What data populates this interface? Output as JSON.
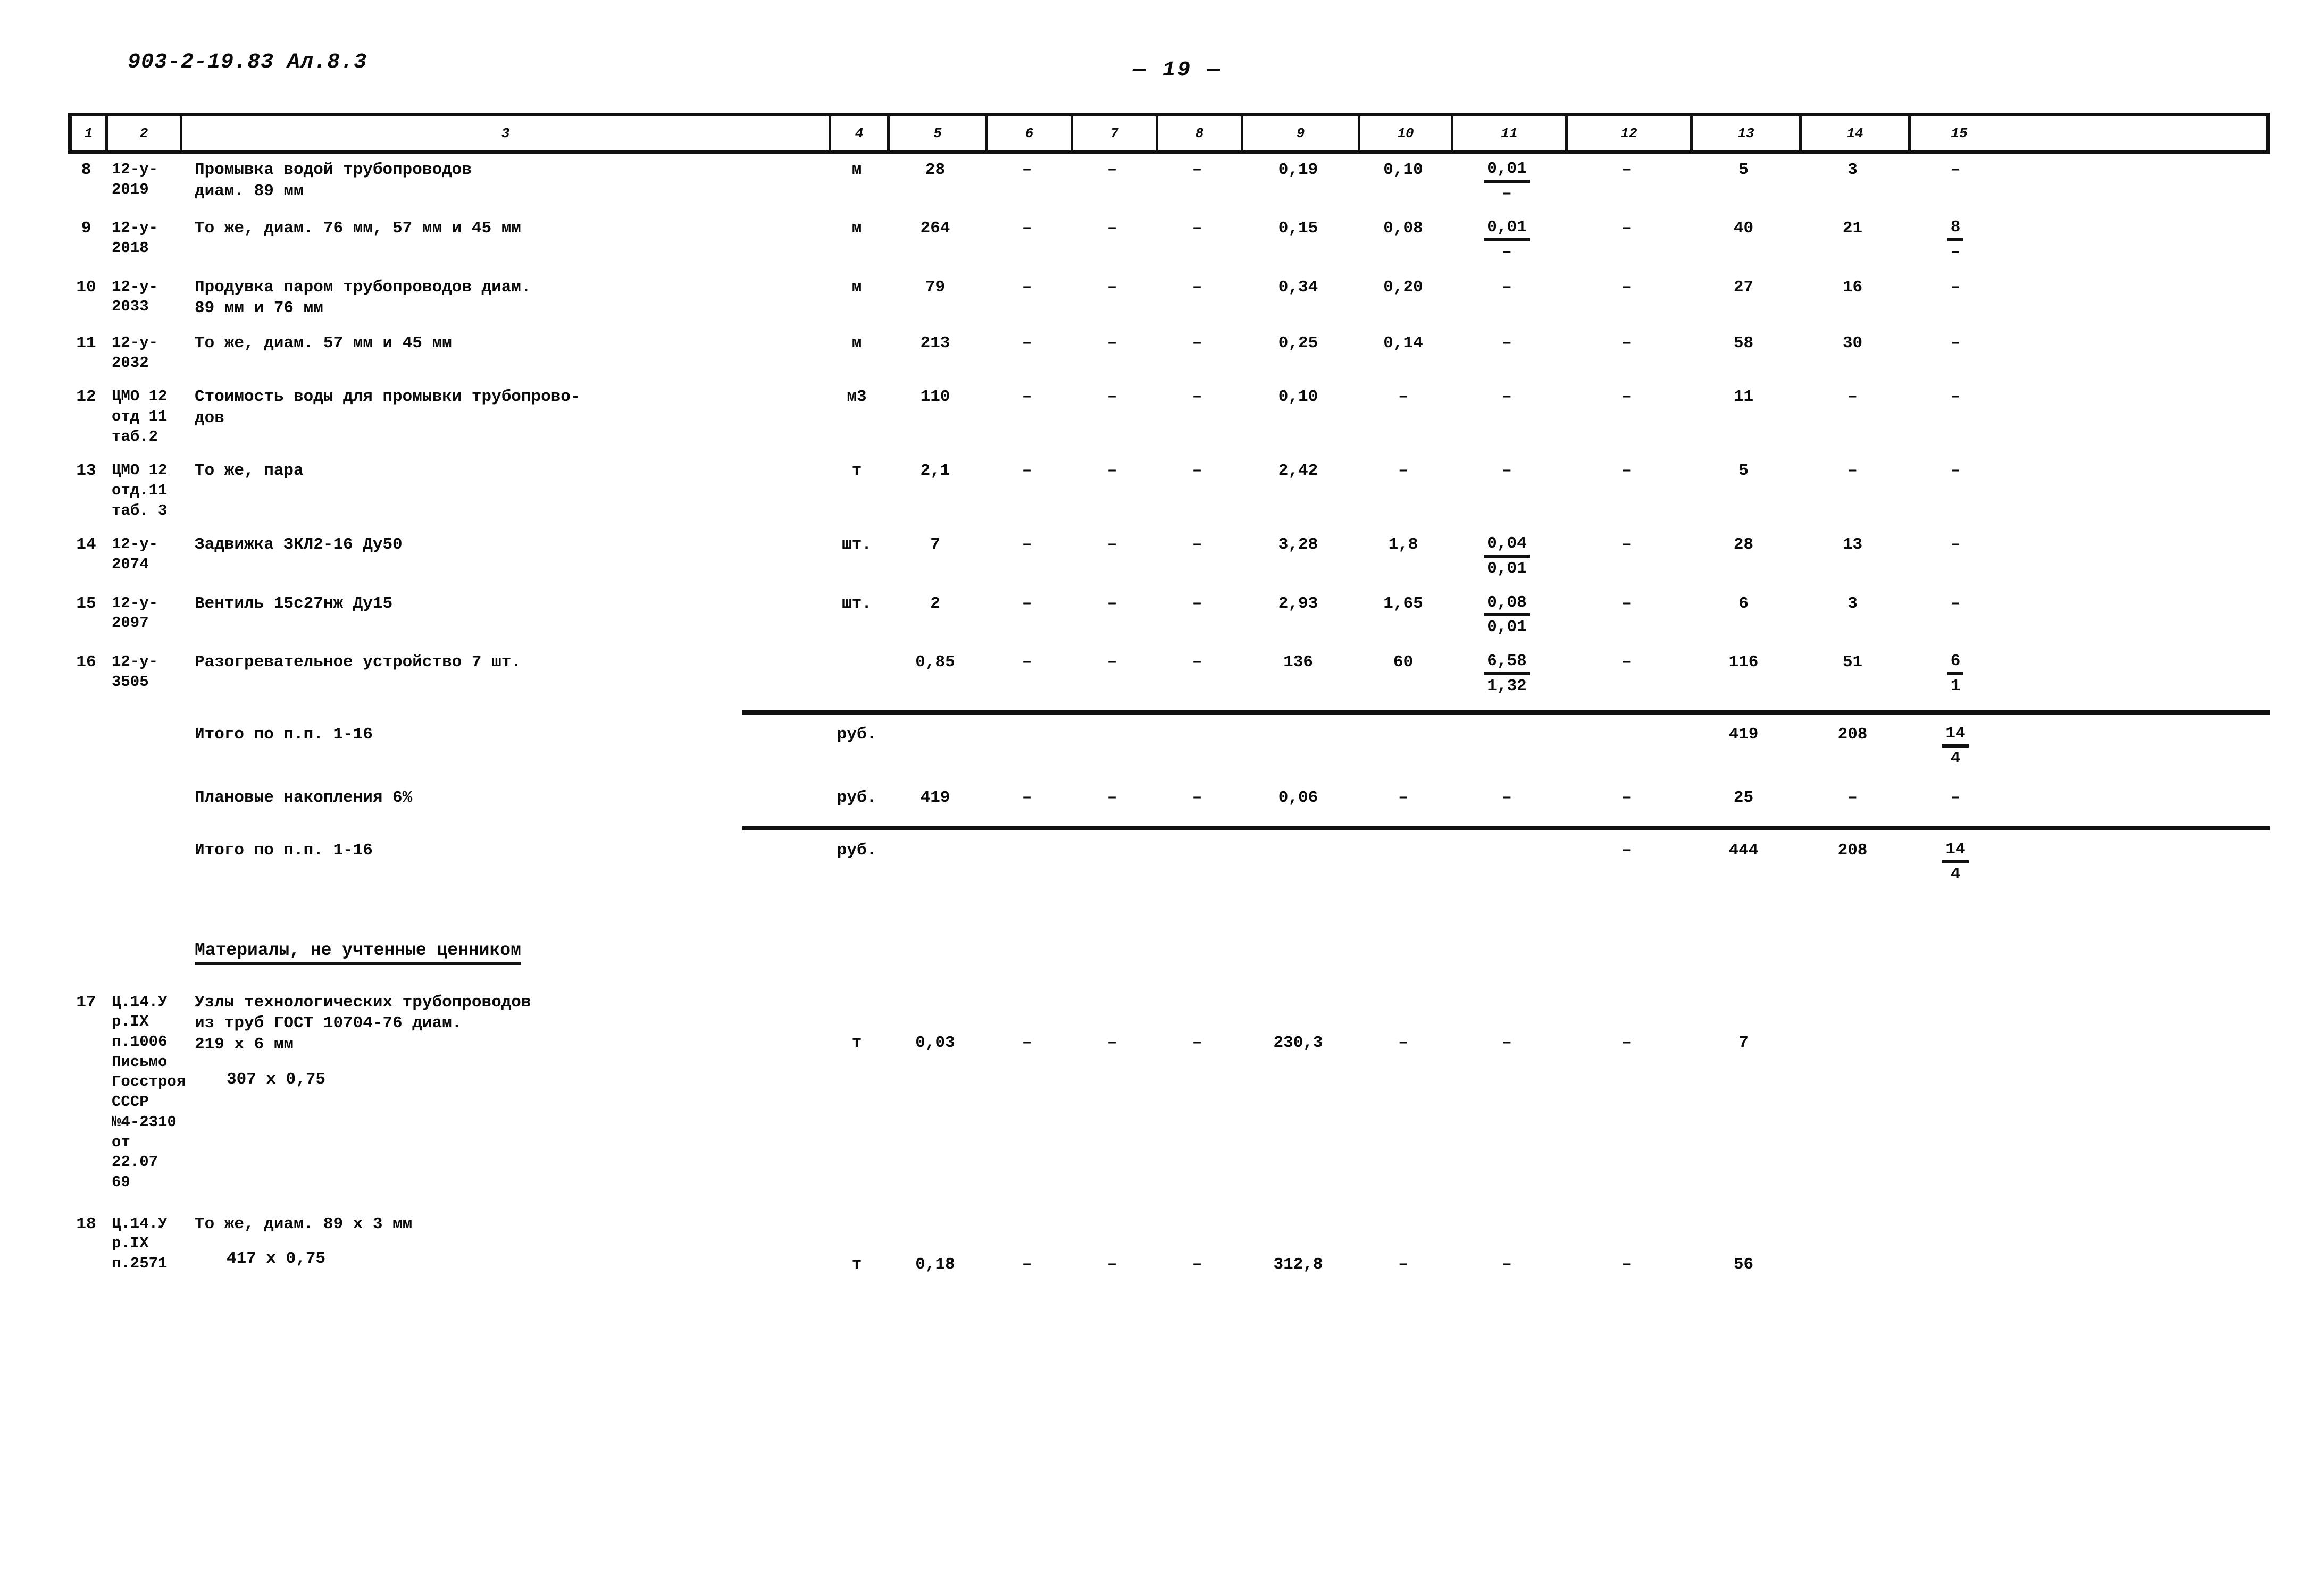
{
  "document": {
    "code": "903-2-19.83 Ал.8.3",
    "page_number": "— 19 —"
  },
  "table": {
    "column_headers": [
      "1",
      "2",
      "3",
      "4",
      "5",
      "6",
      "7",
      "8",
      "9",
      "10",
      "11",
      "12",
      "13",
      "14",
      "15"
    ],
    "rows": [
      {
        "n": "8",
        "ref": "12-у-\n2019",
        "desc": "Промывка водой трубопроводов\nдиам. 89 мм",
        "c4": "м",
        "c5": "28",
        "c6": "–",
        "c7": "–",
        "c8": "–",
        "c9": "0,19",
        "c10": "0,10",
        "c11_top": "0,01",
        "c11_bot": "–",
        "c12": "–",
        "c13": "5",
        "c14": "3",
        "c15": "–"
      },
      {
        "n": "9",
        "ref": "12-у-\n2018",
        "desc": "То же, диам. 76 мм, 57 мм и 45 мм",
        "c4": "м",
        "c5": "264",
        "c6": "–",
        "c7": "–",
        "c8": "–",
        "c9": "0,15",
        "c10": "0,08",
        "c11_top": "0,01",
        "c11_bot": "–",
        "c12": "–",
        "c13": "40",
        "c14": "21",
        "c15_top": "8",
        "c15_bot": "–"
      },
      {
        "n": "10",
        "ref": "12-у-\n2033",
        "desc": "Продувка паром трубопроводов диам.\n89 мм и 76 мм",
        "c4": "м",
        "c5": "79",
        "c6": "–",
        "c7": "–",
        "c8": "–",
        "c9": "0,34",
        "c10": "0,20",
        "c11": "–",
        "c12": "–",
        "c13": "27",
        "c14": "16",
        "c15": "–"
      },
      {
        "n": "11",
        "ref": "12-у-\n2032",
        "desc": "То же, диам. 57 мм и 45 мм",
        "c4": "м",
        "c5": "213",
        "c6": "–",
        "c7": "–",
        "c8": "–",
        "c9": "0,25",
        "c10": "0,14",
        "c11": "–",
        "c12": "–",
        "c13": "58",
        "c14": "30",
        "c15": "–"
      },
      {
        "n": "12",
        "ref": "ЦМО 12\nотд 11\nтаб.2",
        "desc": "Стоимость воды для промывки трубопрово-\nдов",
        "c4": "м3",
        "c5": "110",
        "c6": "–",
        "c7": "–",
        "c8": "–",
        "c9": "0,10",
        "c10": "–",
        "c11": "–",
        "c12": "–",
        "c13": "11",
        "c14": "–",
        "c15": "–"
      },
      {
        "n": "13",
        "ref": "ЦМО 12\nотд.11\nтаб. 3",
        "desc": "То же, пара",
        "c4": "т",
        "c5": "2,1",
        "c6": "–",
        "c7": "–",
        "c8": "–",
        "c9": "2,42",
        "c10": "–",
        "c11": "–",
        "c12": "–",
        "c13": "5",
        "c14": "–",
        "c15": "–"
      },
      {
        "n": "14",
        "ref": "12-у-\n2074",
        "desc": "Задвижка ЗКЛ2-16 Ду50",
        "c4": "шт.",
        "c5": "7",
        "c6": "–",
        "c7": "–",
        "c8": "–",
        "c9": "3,28",
        "c10": "1,8",
        "c11_top": "0,04",
        "c11_bot": "0,01",
        "c12": "–",
        "c13": "28",
        "c14": "13",
        "c15": "–"
      },
      {
        "n": "15",
        "ref": "12-у-\n2097",
        "desc": "Вентиль 15с27нж Ду15",
        "c4": "шт.",
        "c5": "2",
        "c6": "–",
        "c7": "–",
        "c8": "–",
        "c9": "2,93",
        "c10": "1,65",
        "c11_top": "0,08",
        "c11_bot": "0,01",
        "c12": "–",
        "c13": "6",
        "c14": "3",
        "c15": "–"
      },
      {
        "n": "16",
        "ref": "12-у-\n3505",
        "desc": "Разогревательное устройство 7 шт.",
        "c4": "",
        "c5": "0,85",
        "c6": "–",
        "c7": "–",
        "c8": "–",
        "c9": "136",
        "c10": "60",
        "c11_top": "6,58",
        "c11_bot": "1,32",
        "c12": "–",
        "c13": "116",
        "c14": "51",
        "c15_top": "6",
        "c15_bot": "1"
      }
    ],
    "summary_rows": [
      {
        "desc": "Итого по п.п. 1-16",
        "c4": "руб.",
        "c5": "",
        "c6": "",
        "c7": "",
        "c8": "",
        "c9": "",
        "c10": "",
        "c11": "",
        "c12": "",
        "c13": "419",
        "c14": "208",
        "c15_top": "14",
        "c15_bot": "4"
      },
      {
        "desc": "Плановые накопления 6%",
        "c4": "руб.",
        "c5": "419",
        "c6": "–",
        "c7": "–",
        "c8": "–",
        "c9": "0,06",
        "c10": "–",
        "c11": "–",
        "c12": "–",
        "c13": "25",
        "c14": "–",
        "c15": "–"
      },
      {
        "desc": "Итого по п.п. 1-16",
        "c4": "руб.",
        "c5": "",
        "c6": "",
        "c7": "",
        "c8": "",
        "c9": "",
        "c10": "",
        "c11": "",
        "c12": "–",
        "c13": "444",
        "c14": "208",
        "c15_top": "14",
        "c15_bot": "4"
      }
    ],
    "section_title": "Материалы, не учтенные ценником",
    "material_rows": [
      {
        "n": "17",
        "ref": "Ц.14.У\nр.IX\nп.1006\nПисьмо\nГосстроя\nСССР\n№4-2310\nот 22.07\n69",
        "desc": "Узлы технологических трубопроводов\nиз труб ГОСТ 10704-76 диам.\n219 х 6 мм",
        "desc_extra": "307 х 0,75",
        "c4": "т",
        "c5": "0,03",
        "c6": "–",
        "c7": "–",
        "c8": "–",
        "c9": "230,3",
        "c10": "–",
        "c11": "–",
        "c12": "–",
        "c13": "7",
        "c14": "",
        "c15": ""
      },
      {
        "n": "18",
        "ref": "Ц.14.У\nр.IX\nп.2571",
        "desc": "То же, диам. 89 х 3 мм",
        "desc_extra": "417 х 0,75",
        "c4": "т",
        "c5": "0,18",
        "c6": "–",
        "c7": "–",
        "c8": "–",
        "c9": "312,8",
        "c10": "–",
        "c11": "–",
        "c12": "–",
        "c13": "56",
        "c14": "",
        "c15": ""
      }
    ]
  }
}
